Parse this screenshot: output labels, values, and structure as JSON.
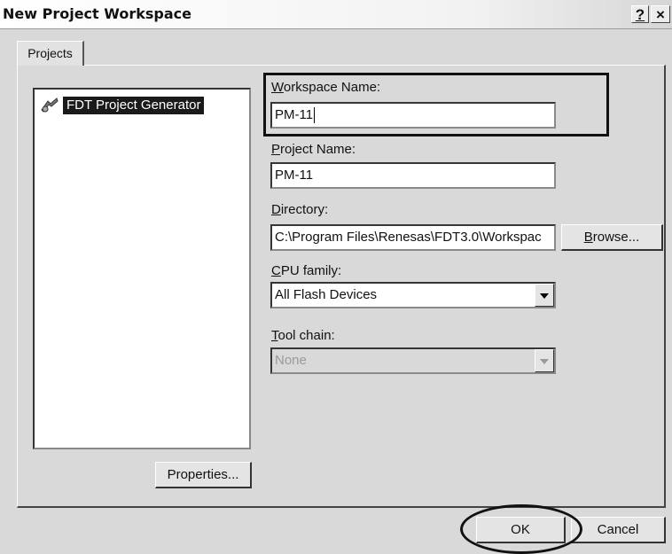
{
  "window": {
    "title": "New Project Workspace",
    "help_label": "?",
    "close_label": "×"
  },
  "tabs": [
    {
      "label": "Projects",
      "selected": true
    }
  ],
  "project_list": {
    "items": [
      {
        "label": "FDT Project Generator",
        "icon": "project-generator-icon",
        "selected": true
      }
    ]
  },
  "properties_button": "Properties...",
  "workspace_name": {
    "label_accel": "W",
    "label_rest": "orkspace Name:",
    "value": "PM-11"
  },
  "project_name": {
    "label_accel": "P",
    "label_rest": "roject Name:",
    "value": "PM-11"
  },
  "directory": {
    "label_accel": "D",
    "label_rest": "irectory:",
    "value": "C:\\Program Files\\Renesas\\FDT3.0\\Workspac"
  },
  "browse_button": {
    "accel": "B",
    "rest": "rowse..."
  },
  "cpu_family": {
    "label_accel": "C",
    "label_rest": "PU family:",
    "value": "All Flash Devices"
  },
  "tool_chain": {
    "label_accel": "T",
    "label_rest": "ool chain:",
    "value": "None",
    "disabled": true
  },
  "buttons": {
    "ok": "OK",
    "cancel": "Cancel"
  },
  "colors": {
    "selection": "#1a1a1a",
    "dialog_bg": "#d9d9d9",
    "highlight_annotation": "#111111"
  }
}
